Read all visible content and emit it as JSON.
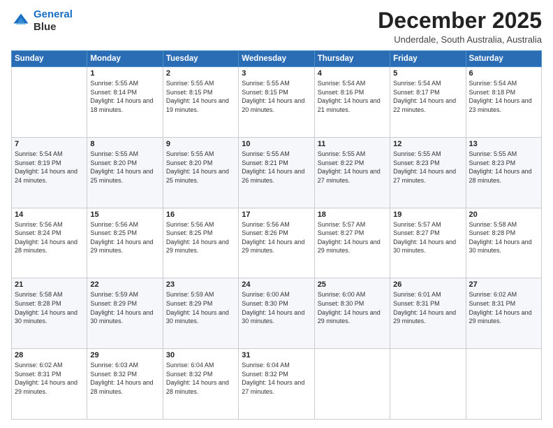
{
  "header": {
    "logo_line1": "General",
    "logo_line2": "Blue",
    "month_title": "December 2025",
    "subtitle": "Underdale, South Australia, Australia"
  },
  "days_of_week": [
    "Sunday",
    "Monday",
    "Tuesday",
    "Wednesday",
    "Thursday",
    "Friday",
    "Saturday"
  ],
  "weeks": [
    [
      {
        "day": "",
        "sunrise": "",
        "sunset": "",
        "daylight": ""
      },
      {
        "day": "1",
        "sunrise": "Sunrise: 5:55 AM",
        "sunset": "Sunset: 8:14 PM",
        "daylight": "Daylight: 14 hours and 18 minutes."
      },
      {
        "day": "2",
        "sunrise": "Sunrise: 5:55 AM",
        "sunset": "Sunset: 8:15 PM",
        "daylight": "Daylight: 14 hours and 19 minutes."
      },
      {
        "day": "3",
        "sunrise": "Sunrise: 5:55 AM",
        "sunset": "Sunset: 8:15 PM",
        "daylight": "Daylight: 14 hours and 20 minutes."
      },
      {
        "day": "4",
        "sunrise": "Sunrise: 5:54 AM",
        "sunset": "Sunset: 8:16 PM",
        "daylight": "Daylight: 14 hours and 21 minutes."
      },
      {
        "day": "5",
        "sunrise": "Sunrise: 5:54 AM",
        "sunset": "Sunset: 8:17 PM",
        "daylight": "Daylight: 14 hours and 22 minutes."
      },
      {
        "day": "6",
        "sunrise": "Sunrise: 5:54 AM",
        "sunset": "Sunset: 8:18 PM",
        "daylight": "Daylight: 14 hours and 23 minutes."
      }
    ],
    [
      {
        "day": "7",
        "sunrise": "Sunrise: 5:54 AM",
        "sunset": "Sunset: 8:19 PM",
        "daylight": "Daylight: 14 hours and 24 minutes."
      },
      {
        "day": "8",
        "sunrise": "Sunrise: 5:55 AM",
        "sunset": "Sunset: 8:20 PM",
        "daylight": "Daylight: 14 hours and 25 minutes."
      },
      {
        "day": "9",
        "sunrise": "Sunrise: 5:55 AM",
        "sunset": "Sunset: 8:20 PM",
        "daylight": "Daylight: 14 hours and 25 minutes."
      },
      {
        "day": "10",
        "sunrise": "Sunrise: 5:55 AM",
        "sunset": "Sunset: 8:21 PM",
        "daylight": "Daylight: 14 hours and 26 minutes."
      },
      {
        "day": "11",
        "sunrise": "Sunrise: 5:55 AM",
        "sunset": "Sunset: 8:22 PM",
        "daylight": "Daylight: 14 hours and 27 minutes."
      },
      {
        "day": "12",
        "sunrise": "Sunrise: 5:55 AM",
        "sunset": "Sunset: 8:23 PM",
        "daylight": "Daylight: 14 hours and 27 minutes."
      },
      {
        "day": "13",
        "sunrise": "Sunrise: 5:55 AM",
        "sunset": "Sunset: 8:23 PM",
        "daylight": "Daylight: 14 hours and 28 minutes."
      }
    ],
    [
      {
        "day": "14",
        "sunrise": "Sunrise: 5:56 AM",
        "sunset": "Sunset: 8:24 PM",
        "daylight": "Daylight: 14 hours and 28 minutes."
      },
      {
        "day": "15",
        "sunrise": "Sunrise: 5:56 AM",
        "sunset": "Sunset: 8:25 PM",
        "daylight": "Daylight: 14 hours and 29 minutes."
      },
      {
        "day": "16",
        "sunrise": "Sunrise: 5:56 AM",
        "sunset": "Sunset: 8:25 PM",
        "daylight": "Daylight: 14 hours and 29 minutes."
      },
      {
        "day": "17",
        "sunrise": "Sunrise: 5:56 AM",
        "sunset": "Sunset: 8:26 PM",
        "daylight": "Daylight: 14 hours and 29 minutes."
      },
      {
        "day": "18",
        "sunrise": "Sunrise: 5:57 AM",
        "sunset": "Sunset: 8:27 PM",
        "daylight": "Daylight: 14 hours and 29 minutes."
      },
      {
        "day": "19",
        "sunrise": "Sunrise: 5:57 AM",
        "sunset": "Sunset: 8:27 PM",
        "daylight": "Daylight: 14 hours and 30 minutes."
      },
      {
        "day": "20",
        "sunrise": "Sunrise: 5:58 AM",
        "sunset": "Sunset: 8:28 PM",
        "daylight": "Daylight: 14 hours and 30 minutes."
      }
    ],
    [
      {
        "day": "21",
        "sunrise": "Sunrise: 5:58 AM",
        "sunset": "Sunset: 8:28 PM",
        "daylight": "Daylight: 14 hours and 30 minutes."
      },
      {
        "day": "22",
        "sunrise": "Sunrise: 5:59 AM",
        "sunset": "Sunset: 8:29 PM",
        "daylight": "Daylight: 14 hours and 30 minutes."
      },
      {
        "day": "23",
        "sunrise": "Sunrise: 5:59 AM",
        "sunset": "Sunset: 8:29 PM",
        "daylight": "Daylight: 14 hours and 30 minutes."
      },
      {
        "day": "24",
        "sunrise": "Sunrise: 6:00 AM",
        "sunset": "Sunset: 8:30 PM",
        "daylight": "Daylight: 14 hours and 30 minutes."
      },
      {
        "day": "25",
        "sunrise": "Sunrise: 6:00 AM",
        "sunset": "Sunset: 8:30 PM",
        "daylight": "Daylight: 14 hours and 29 minutes."
      },
      {
        "day": "26",
        "sunrise": "Sunrise: 6:01 AM",
        "sunset": "Sunset: 8:31 PM",
        "daylight": "Daylight: 14 hours and 29 minutes."
      },
      {
        "day": "27",
        "sunrise": "Sunrise: 6:02 AM",
        "sunset": "Sunset: 8:31 PM",
        "daylight": "Daylight: 14 hours and 29 minutes."
      }
    ],
    [
      {
        "day": "28",
        "sunrise": "Sunrise: 6:02 AM",
        "sunset": "Sunset: 8:31 PM",
        "daylight": "Daylight: 14 hours and 29 minutes."
      },
      {
        "day": "29",
        "sunrise": "Sunrise: 6:03 AM",
        "sunset": "Sunset: 8:32 PM",
        "daylight": "Daylight: 14 hours and 28 minutes."
      },
      {
        "day": "30",
        "sunrise": "Sunrise: 6:04 AM",
        "sunset": "Sunset: 8:32 PM",
        "daylight": "Daylight: 14 hours and 28 minutes."
      },
      {
        "day": "31",
        "sunrise": "Sunrise: 6:04 AM",
        "sunset": "Sunset: 8:32 PM",
        "daylight": "Daylight: 14 hours and 27 minutes."
      },
      {
        "day": "",
        "sunrise": "",
        "sunset": "",
        "daylight": ""
      },
      {
        "day": "",
        "sunrise": "",
        "sunset": "",
        "daylight": ""
      },
      {
        "day": "",
        "sunrise": "",
        "sunset": "",
        "daylight": ""
      }
    ]
  ]
}
